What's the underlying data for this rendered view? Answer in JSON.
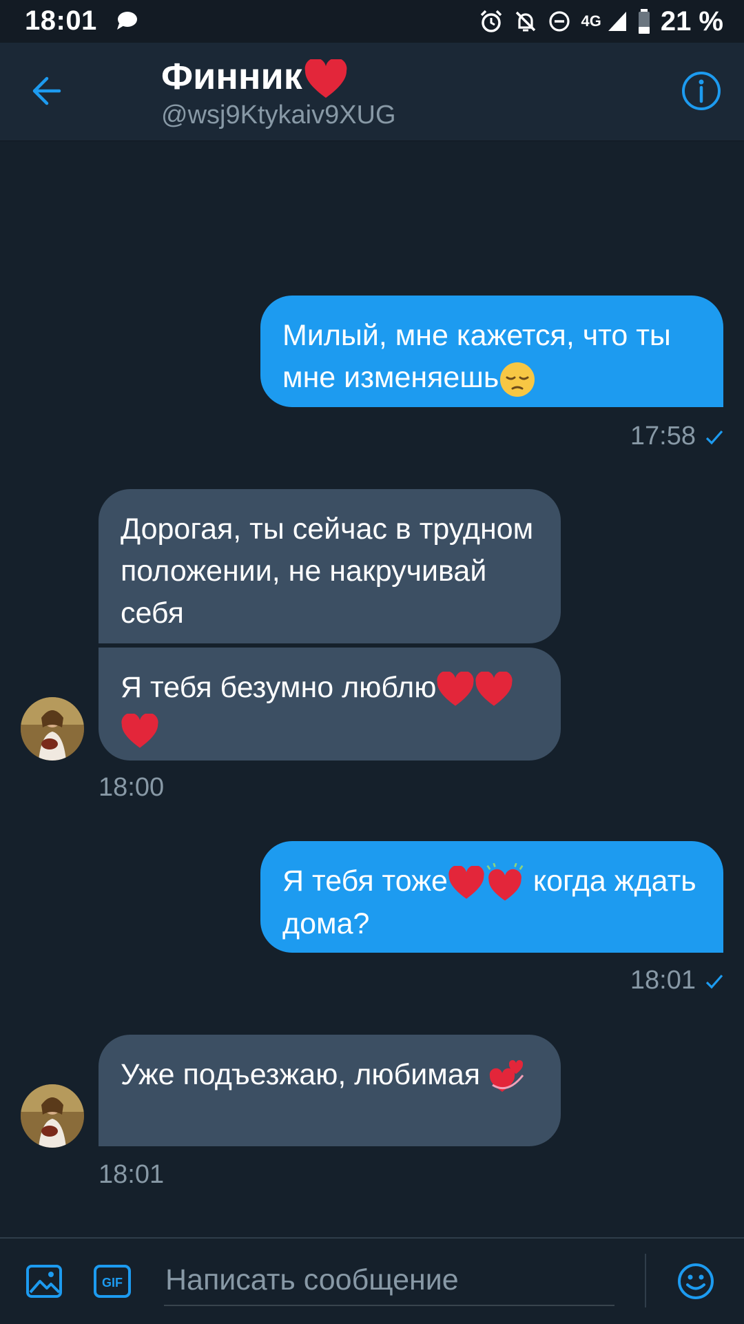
{
  "status_bar": {
    "time": "18:01",
    "network": "4G",
    "battery": "21 %"
  },
  "header": {
    "name": "Финник",
    "handle": "@wsj9Ktykaiv9XUG"
  },
  "messages": [
    {
      "direction": "out",
      "text": "Милый, мне кажется, что ты мне изменяешь",
      "emoji": "pensive-face",
      "time": "17:58"
    },
    {
      "direction": "in",
      "text": "Дорогая, ты сейчас в трудном положении, не накручивай себя"
    },
    {
      "direction": "in",
      "text": "Я тебя безумно люблю",
      "emoji": "red-hearts",
      "time": "18:00"
    },
    {
      "direction": "out",
      "text_before": "Я тебя тоже",
      "text_after": " когда ждать дома?",
      "emoji": "heart-and-growing-heart",
      "time": "18:01"
    },
    {
      "direction": "in",
      "text": "Уже подъезжаю, любимая",
      "emoji": "revolving-hearts",
      "time": "18:01"
    }
  ],
  "composer": {
    "placeholder": "Написать сообщение"
  },
  "colors": {
    "background": "#15202b",
    "header": "#1b2836",
    "outgoing_bubble": "#1d9bf0",
    "incoming_bubble": "#3c4f63",
    "accent": "#1d9bf0",
    "muted_text": "#8899a6"
  }
}
